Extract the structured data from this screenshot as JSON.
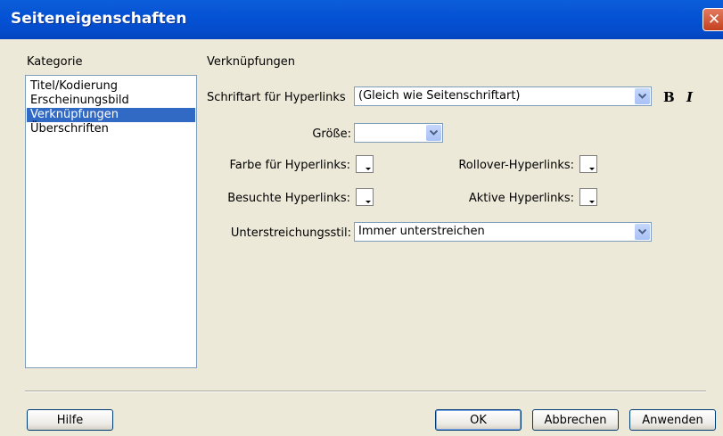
{
  "window": {
    "title": "Seiteneigenschaften",
    "close_glyph": "✕"
  },
  "category": {
    "label": "Kategorie",
    "items": [
      "Titel/Kodierung",
      "Erscheinungsbild",
      "Verknüpfungen",
      "Überschriften"
    ],
    "selected_index": 2
  },
  "section": {
    "title": "Verknüpfungen"
  },
  "font": {
    "label": "Schriftart für Hyperlinks",
    "value": "(Gleich wie Seitenschriftart)",
    "bold_label": "B",
    "italic_label": "I"
  },
  "size": {
    "label": "Größe:",
    "value": ""
  },
  "colors": {
    "link_label": "Farbe für Hyperlinks:",
    "rollover_label": "Rollover-Hyperlinks:",
    "visited_label": "Besuchte Hyperlinks:",
    "active_label": "Aktive Hyperlinks:"
  },
  "underline": {
    "label": "Unterstreichungsstil:",
    "value": "Immer unterstreichen"
  },
  "buttons": {
    "help": "Hilfe",
    "ok": "OK",
    "cancel": "Abbrechen",
    "apply": "Anwenden"
  },
  "theme": {
    "titlebar": "#0553D6",
    "selection": "#316AC5",
    "dialog_bg": "#ECE9D8"
  }
}
